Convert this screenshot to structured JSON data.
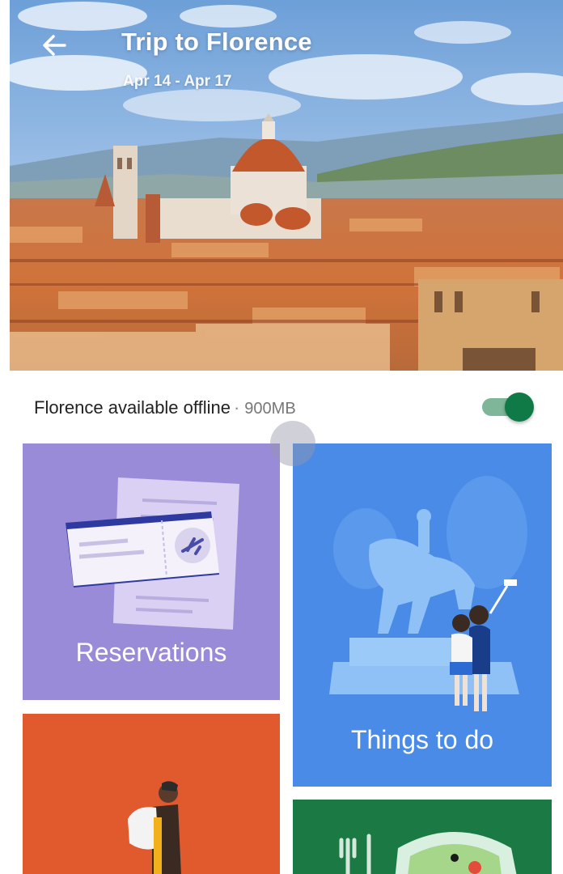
{
  "header": {
    "title": "Trip to Florence",
    "dates": "Apr 14 - Apr 17",
    "back_icon": "arrow-back-icon"
  },
  "offline": {
    "label": "Florence available offline",
    "separator": "·",
    "size": "900MB",
    "enabled": true
  },
  "cards": {
    "reservations": {
      "label": "Reservations",
      "color": "#9a8bd9"
    },
    "things_to_do": {
      "label": "Things to do",
      "color": "#4a8be8"
    },
    "food": {
      "color": "#e05a2e"
    },
    "restaurants": {
      "color": "#1b7a44"
    }
  },
  "colors": {
    "toggle_on": "#0f7a45",
    "toggle_track": "#7fb69a"
  }
}
